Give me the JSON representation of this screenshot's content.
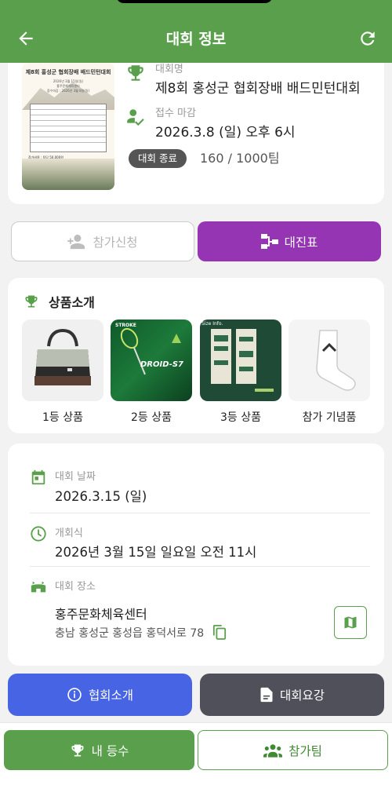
{
  "header": {
    "title": "대회 정보",
    "back_icon": "arrow-left-icon",
    "refresh_icon": "refresh-icon",
    "color": "#5aa04c"
  },
  "tournament": {
    "name_label": "대회명",
    "name": "제8회 홍성군 협회장배 배드민턴대회",
    "deadline_label": "접수 마감",
    "deadline": "2026.3.8 (일) 오후 6시",
    "status": "대회 종료",
    "team_count": "160 / 1000팀",
    "poster": {
      "title": "제8회 홍성군 협회장배 배드민턴대회",
      "lines": [
        "2026년 3월 15일(일)",
        "홍주문화체육센터",
        "접수마감 : 2026년 3월 8일(일)"
      ],
      "notes": [
        "참가비용 : 팀당 50,000원",
        "계좌번호 : 카카오뱅크 3333-31-7147859 김한우",
        "접수문의 : 총무 010-4401-9539"
      ]
    }
  },
  "actions": {
    "apply_label": "참가신청",
    "apply_icon": "person-add-icon",
    "bracket_label": "대진표",
    "bracket_icon": "bracket-icon",
    "bracket_color": "#9535b3"
  },
  "prizes": {
    "title": "상품소개",
    "items": [
      {
        "label": "1등 상품",
        "image": "duffel-bag"
      },
      {
        "label": "2등 상품",
        "image": "badminton-racket",
        "text": "DROID-S7",
        "brand": "STROKE"
      },
      {
        "label": "3등 상품",
        "image": "sports-towel",
        "badge": "Size Info."
      },
      {
        "label": "참가 기념품",
        "image": "white-socks"
      }
    ]
  },
  "details": {
    "date_label": "대회 날짜",
    "date": "2026.3.15 (일)",
    "ceremony_label": "개회식",
    "ceremony": "2026년 3월 15일 일요일 오전 11시",
    "venue_label": "대회 장소",
    "venue": "홍주문화체육센터",
    "address": "충남 홍성군 홍성읍 홍덕서로 78"
  },
  "buttons": {
    "association_label": "협회소개",
    "guide_label": "대회요강",
    "my_rank_label": "내 등수",
    "teams_label": "참가팀"
  }
}
